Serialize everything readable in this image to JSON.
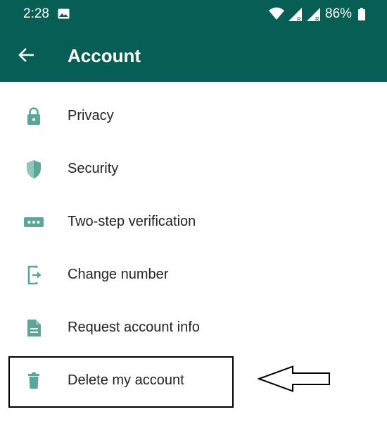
{
  "status_bar": {
    "time": "2:28",
    "battery": "86%",
    "icons": [
      "gallery-icon",
      "wifi-icon",
      "signal-icon",
      "signal-icon",
      "battery-icon"
    ]
  },
  "app_bar": {
    "title": "Account",
    "back_icon": "arrow-left-icon"
  },
  "menu": {
    "items": [
      {
        "label": "Privacy",
        "icon": "lock-icon"
      },
      {
        "label": "Security",
        "icon": "shield-icon"
      },
      {
        "label": "Two-step verification",
        "icon": "dots-icon"
      },
      {
        "label": "Change number",
        "icon": "phone-change-icon"
      },
      {
        "label": "Request account info",
        "icon": "document-icon"
      },
      {
        "label": "Delete my account",
        "icon": "trash-icon"
      }
    ]
  },
  "annotation": {
    "highlight": "box around Delete my account",
    "arrow": "arrow-left-outline-icon"
  },
  "colors": {
    "primary": "#075e54",
    "icon": "#5aa69a",
    "text": "#222222"
  }
}
